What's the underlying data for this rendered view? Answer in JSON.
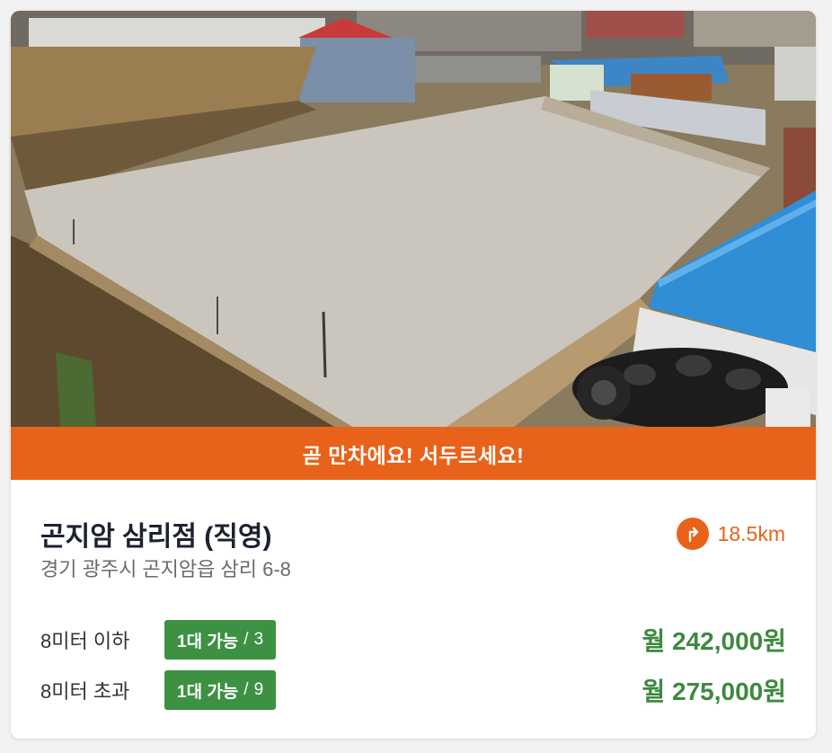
{
  "banner": {
    "text": "곧 만차에요! 서두르세요!",
    "color": "#e8621a"
  },
  "lot": {
    "name": "곤지암 삼리점 (직영)",
    "address": "경기 광주시 곤지암읍 삼리 6-8",
    "distance": "18.5km",
    "distance_icon": "directions-icon"
  },
  "rates": [
    {
      "label": "8미터 이하",
      "availability": "1대 가능",
      "total": "3",
      "price": "월 242,000원"
    },
    {
      "label": "8미터 초과",
      "availability": "1대 가능",
      "total": "9",
      "price": "월 275,000원"
    }
  ],
  "colors": {
    "accent": "#e8621a",
    "badge_green": "#3d9142",
    "price_green": "#3d8a3e"
  }
}
